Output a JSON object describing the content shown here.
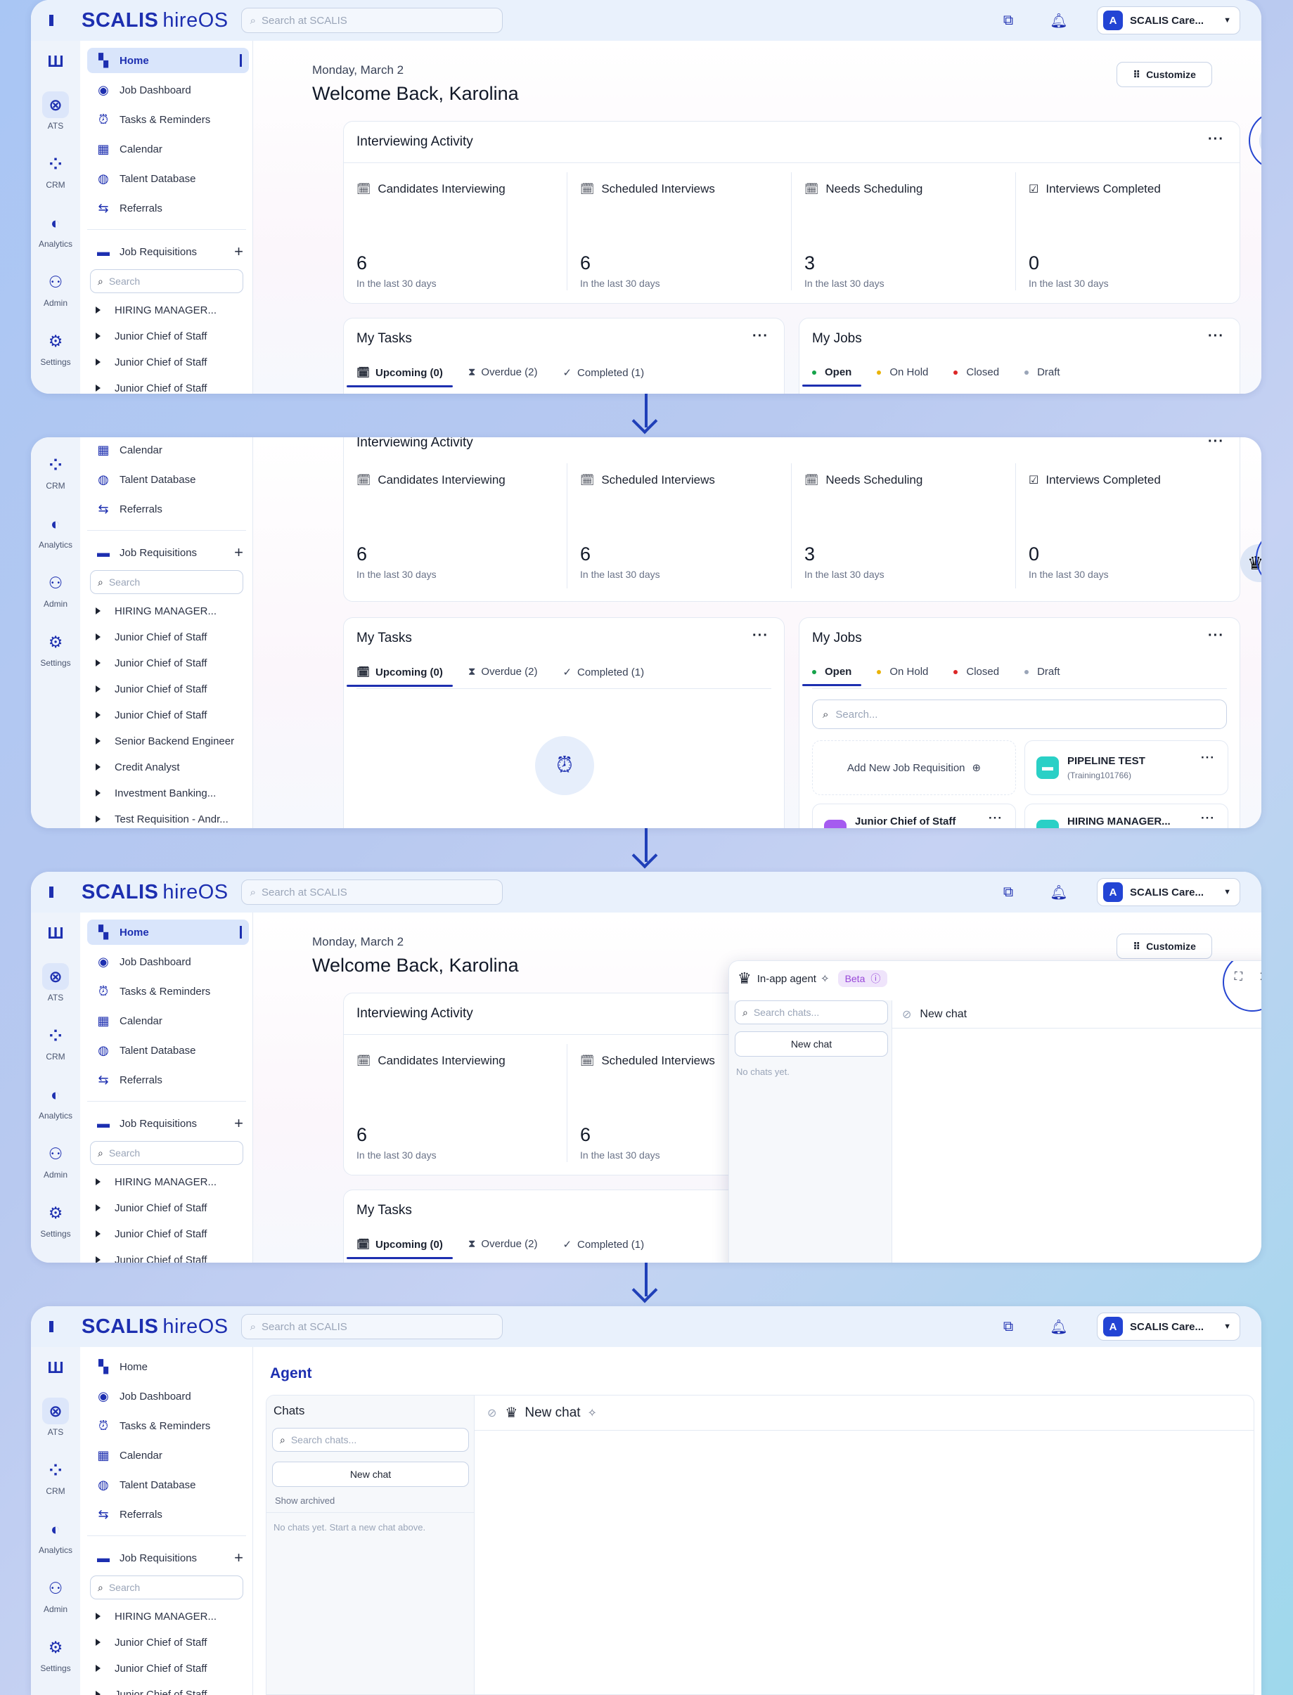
{
  "app": {
    "brand": "SCALIS",
    "brand_suffix": "hireOS",
    "global_search_placeholder": "Search at SCALIS",
    "org_name": "SCALIS Care...",
    "org_badge": "A"
  },
  "rail": [
    {
      "label": "",
      "icon": "jobs-icon"
    },
    {
      "label": "ATS",
      "icon": "ats-icon"
    },
    {
      "label": "CRM",
      "icon": "crm-icon"
    },
    {
      "label": "Analytics",
      "icon": "analytics-icon"
    },
    {
      "label": "Admin",
      "icon": "admin-icon"
    },
    {
      "label": "Settings",
      "icon": "settings-icon"
    }
  ],
  "sidebar": {
    "nav": [
      {
        "label": "Home",
        "icon": "home-icon"
      },
      {
        "label": "Job Dashboard",
        "icon": "dashboard-icon"
      },
      {
        "label": "Tasks & Reminders",
        "icon": "tasks-icon"
      },
      {
        "label": "Calendar",
        "icon": "calendar-icon"
      },
      {
        "label": "Talent Database",
        "icon": "talent-icon"
      },
      {
        "label": "Referrals",
        "icon": "referrals-icon"
      }
    ],
    "requisitions_label": "Job Requisitions",
    "search_placeholder": "Search",
    "requisitions": [
      "HIRING MANAGER...",
      "Junior Chief of Staff",
      "Junior Chief of Staff",
      "Junior Chief of Staff",
      "Junior Chief of Staff",
      "Junior Chief of Staff",
      "Senior Backend Engineer",
      "Credit Analyst",
      "Investment Banking...",
      "Test Requisition - Andr..."
    ]
  },
  "home": {
    "date": "Monday, March 2",
    "welcome": "Welcome Back, Karolina",
    "customize": "Customize",
    "activity_title": "Interviewing Activity",
    "stats": [
      {
        "label": "Candidates Interviewing",
        "value": "6",
        "sub": "In the last 30 days"
      },
      {
        "label": "Scheduled Interviews",
        "value": "6",
        "sub": "In the last 30 days"
      },
      {
        "label": "Needs Scheduling",
        "value": "3",
        "sub": "In the last 30 days"
      },
      {
        "label": "Interviews Completed",
        "value": "0",
        "sub": "In the last 30 days"
      }
    ],
    "tasks_title": "My Tasks",
    "task_tabs": [
      "Upcoming (0)",
      "Overdue (2)",
      "Completed (1)"
    ],
    "jobs_title": "My Jobs",
    "job_tabs": [
      {
        "label": "Open",
        "color": "#16a34a"
      },
      {
        "label": "On Hold",
        "color": "#eab308"
      },
      {
        "label": "Closed",
        "color": "#dc2626"
      },
      {
        "label": "Draft",
        "color": "#9aa5b8"
      }
    ],
    "jobs_search_placeholder": "Search...",
    "add_job": "Add New Job Requisition",
    "job_cards": [
      {
        "title": "PIPELINE TEST",
        "sub": "(Training101766)",
        "color": "#2ad0c6"
      },
      {
        "title": "Junior Chief of Staff",
        "color": "#a55bf0"
      },
      {
        "title": "HIRING MANAGER...",
        "color": "#2ad0c6"
      }
    ]
  },
  "agent_popup": {
    "title": "In-app agent",
    "beta": "Beta",
    "search_placeholder": "Search chats...",
    "new_chat_button": "New chat",
    "empty": "No chats yet.",
    "current_chat": "New chat"
  },
  "agent_page": {
    "title": "Agent",
    "chats_label": "Chats",
    "search_placeholder": "Search chats...",
    "new_chat_button": "New chat",
    "show_archived": "Show archived",
    "empty": "No chats yet. Start a new chat above.",
    "current_chat": "New chat"
  },
  "colors": {
    "brand": "#1d2fb0",
    "accent": "#2544d0"
  }
}
